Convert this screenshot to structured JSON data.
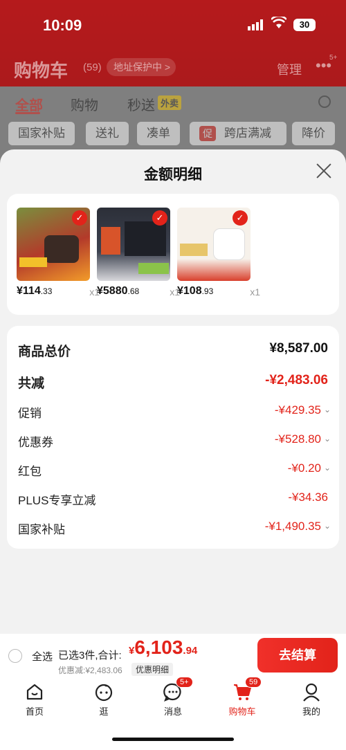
{
  "status": {
    "time": "10:09",
    "battery": "30"
  },
  "header": {
    "title": "购物车",
    "count": "(59)",
    "address": "地址保护中 >",
    "manage": "管理",
    "more_badge": "5+"
  },
  "tabs": [
    {
      "label": "全部"
    },
    {
      "label": "购物"
    },
    {
      "label": "秒送"
    }
  ],
  "flash_tag": "外卖",
  "chips": [
    {
      "label": "国家补贴"
    },
    {
      "label": "送礼"
    },
    {
      "label": "凑单"
    },
    {
      "label": "跨店满减",
      "tag": "促"
    },
    {
      "label": "降价"
    }
  ],
  "sheet": {
    "title": "金额明细"
  },
  "products": [
    {
      "price": "¥114",
      "price_dec": ".33",
      "qty": "x1",
      "colors": [
        "#b33a2a",
        "#6b8a3e",
        "#f29c2a"
      ]
    },
    {
      "price": "¥5880",
      "price_dec": ".68",
      "qty": "x1",
      "colors": [
        "#2c2f38",
        "#d8542a",
        "#e9e9ec"
      ]
    },
    {
      "price": "¥108",
      "price_dec": ".93",
      "qty": "x1",
      "colors": [
        "#f6f1ea",
        "#d9402c",
        "#e7c56a"
      ]
    }
  ],
  "summary": {
    "total_label": "商品总价",
    "total_value": "¥8,587.00",
    "reduce_label": "共减",
    "reduce_value": "-¥2,483.06",
    "promo_label": "促销",
    "promo_value": "-¥429.35",
    "coupon_label": "优惠券",
    "coupon_value": "-¥528.80",
    "redpack_label": "红包",
    "redpack_value": "-¥0.20",
    "plus_label": "PLUS专享立减",
    "plus_value": "-¥34.36",
    "subsidy_label": "国家补贴",
    "subsidy_value": "-¥1,490.35"
  },
  "bottom": {
    "select_all": "全选",
    "selected": "已选3件,合计:",
    "currency": "¥",
    "total_int": "6,103",
    "total_dec": ".94",
    "discount": "优惠减:¥2,483.06",
    "detail": "优惠明细",
    "checkout": "去结算"
  },
  "tabbar": [
    {
      "label": "首页"
    },
    {
      "label": "逛"
    },
    {
      "label": "消息",
      "badge": "5+"
    },
    {
      "label": "购物车",
      "badge": "59"
    },
    {
      "label": "我的"
    }
  ]
}
